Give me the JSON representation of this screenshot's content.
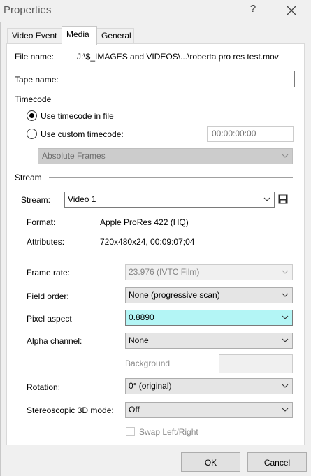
{
  "window": {
    "title": "Properties",
    "help": "?"
  },
  "tabs": [
    {
      "label": "Video Event"
    },
    {
      "label": "Media"
    },
    {
      "label": "General"
    }
  ],
  "file": {
    "label": "File name:",
    "value": "J:\\$_IMAGES and VIDEOS\\...\\roberta pro res test.mov"
  },
  "tape": {
    "label": "Tape name:",
    "value": ""
  },
  "timecode": {
    "section": "Timecode",
    "use_file": "Use timecode in file",
    "use_custom": "Use custom timecode:",
    "custom_value": "00:00:00:00",
    "format": "Absolute Frames"
  },
  "stream": {
    "section": "Stream",
    "label": "Stream:",
    "value": "Video 1",
    "format_label": "Format:",
    "format_value": "Apple ProRes 422 (HQ)",
    "attributes_label": "Attributes:",
    "attributes_value": "720x480x24, 00:09:07;04"
  },
  "settings": {
    "frame_rate_label": "Frame rate:",
    "frame_rate_value": "23.976 (IVTC Film)",
    "field_order_label": "Field order:",
    "field_order_value": "None (progressive scan)",
    "pixel_aspect_label": "Pixel aspect",
    "pixel_aspect_value": "0.8890",
    "alpha_label": "Alpha channel:",
    "alpha_value": "None",
    "background_label": "Background",
    "rotation_label": "Rotation:",
    "rotation_value": "0° (original)",
    "stereo_label": "Stereoscopic 3D mode:",
    "stereo_value": "Off",
    "swap_label": "Swap Left/Right"
  },
  "buttons": {
    "ok": "OK",
    "cancel": "Cancel"
  },
  "colors": {
    "highlight": "#b3f5f5",
    "window_bg": "#f0f0f0",
    "panel_bg": "#ffffff"
  }
}
